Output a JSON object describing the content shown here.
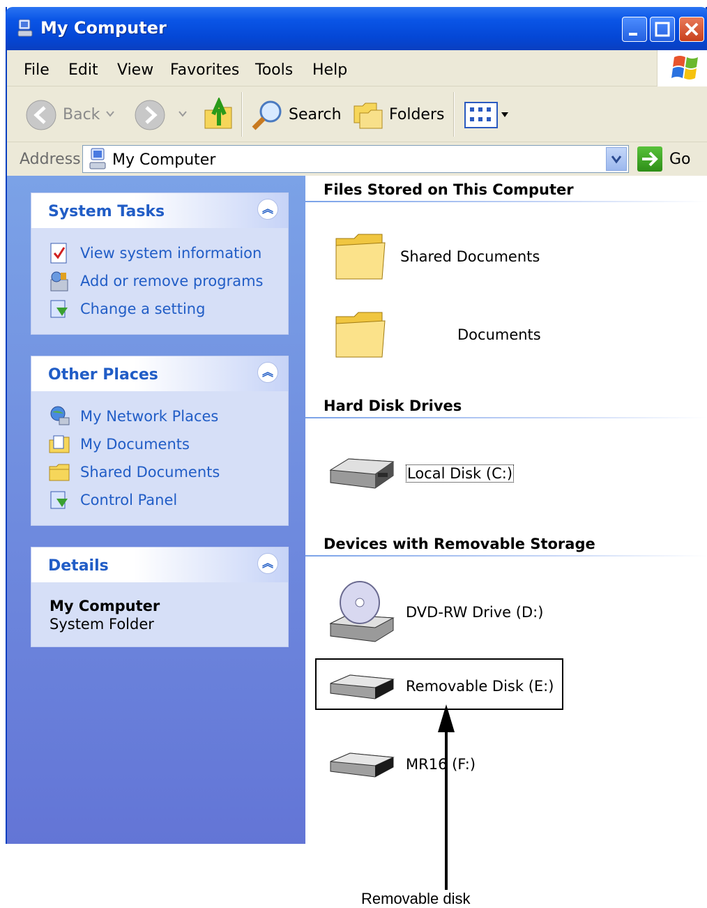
{
  "window": {
    "title": "My Computer"
  },
  "menu": [
    "File",
    "Edit",
    "View",
    "Favorites",
    "Tools",
    "Help"
  ],
  "toolbar": {
    "back": "Back",
    "search": "Search",
    "folders": "Folders"
  },
  "address": {
    "label": "Address",
    "value": "My Computer",
    "go": "Go"
  },
  "left_pane": {
    "system_tasks": {
      "title": "System Tasks",
      "items": [
        "View system information",
        "Add or remove programs",
        "Change a setting"
      ]
    },
    "other_places": {
      "title": "Other Places",
      "items": [
        "My Network Places",
        "My Documents",
        "Shared Documents",
        "Control Panel"
      ]
    },
    "details": {
      "title": "Details",
      "name": "My Computer",
      "type": "System Folder"
    }
  },
  "content": {
    "files_stored": {
      "title": "Files Stored on This Computer",
      "items": [
        "Shared Documents",
        "Documents"
      ]
    },
    "hard_disk": {
      "title": "Hard Disk Drives",
      "items": [
        "Local Disk (C:)"
      ]
    },
    "removable": {
      "title": "Devices with Removable Storage",
      "items": [
        "DVD-RW Drive (D:)",
        "Removable Disk (E:)",
        "MR16 (F:)"
      ]
    }
  },
  "callout": "Removable disk",
  "colors": {
    "title_bar": "#0a55e6",
    "task_pane": "#7ba2e7",
    "link": "#215dc6"
  }
}
